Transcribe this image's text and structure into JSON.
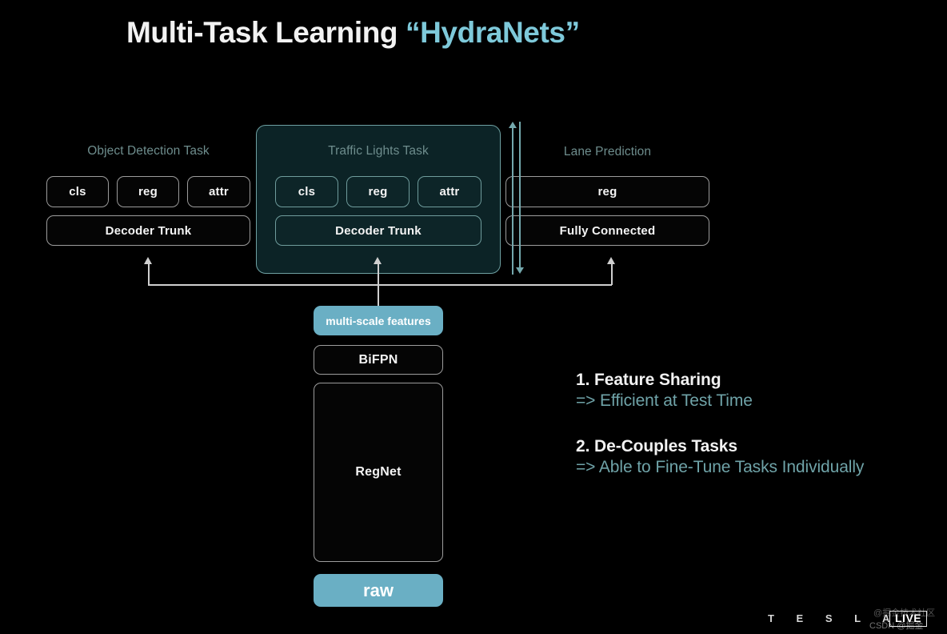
{
  "title": {
    "main": "Multi-Task Learning ",
    "accent": "“HydraNets”"
  },
  "tasks": [
    {
      "header": "Object Detection Task",
      "heads": [
        "cls",
        "reg",
        "attr"
      ],
      "trunk": "Decoder Trunk",
      "highlighted": false
    },
    {
      "header": "Traffic Lights Task",
      "heads": [
        "cls",
        "reg",
        "attr"
      ],
      "trunk": "Decoder Trunk",
      "highlighted": true
    },
    {
      "header": "Lane Prediction",
      "heads": [
        "reg"
      ],
      "trunk": "Fully Connected",
      "highlighted": false
    }
  ],
  "backbone": {
    "features": "multi-scale features",
    "neck": "BiFPN",
    "body": "RegNet",
    "input": "raw"
  },
  "bullets": [
    {
      "title": "1. Feature Sharing",
      "sub": "=> Efficient at Test Time"
    },
    {
      "title": "2. De-Couples Tasks",
      "sub": "=> Able to Fine-Tune Tasks Individually"
    }
  ],
  "footer": {
    "brand": "T E S L A",
    "live": "LIVE",
    "watermark_cn": "@掘金技术社区",
    "watermark_csdn": "CSDN @掘金"
  },
  "colors": {
    "background": "#000000",
    "accent_teal": "#7ec9da",
    "fill_blue": "#6aafc4",
    "panel_bg": "#0c2326",
    "panel_border": "#6ea0a2",
    "node_border": "#9c9c9c",
    "header_text": "#6e8d8d",
    "bullet_sub": "#6fa3a8"
  }
}
